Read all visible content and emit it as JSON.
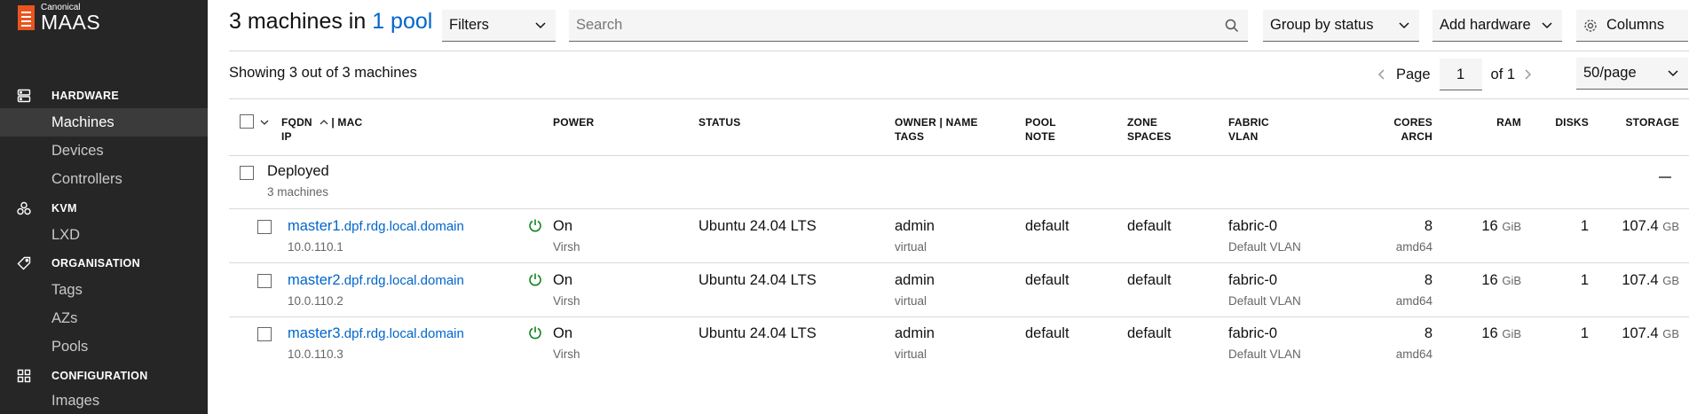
{
  "sidebar": {
    "brand_small": "Canonical",
    "brand_big": "MAAS",
    "sections": [
      {
        "label": "HARDWARE",
        "icon": "server-icon"
      },
      {
        "label": "KVM",
        "icon": "cluster-icon"
      },
      {
        "label": "ORGANISATION",
        "icon": "tag-icon"
      },
      {
        "label": "CONFIGURATION",
        "icon": "grid-icon"
      }
    ],
    "items": {
      "machines": "Machines",
      "devices": "Devices",
      "controllers": "Controllers",
      "lxd": "LXD",
      "tags": "Tags",
      "azs": "AZs",
      "pools": "Pools",
      "images": "Images"
    }
  },
  "header": {
    "title_prefix": "3 machines in ",
    "title_link": "1 pool",
    "filters_label": "Filters",
    "search_placeholder": "Search",
    "group_by_label": "Group by status",
    "add_hardware_label": "Add hardware",
    "columns_label": "Columns"
  },
  "summary": {
    "showing": "Showing 3 out of 3 machines",
    "page_label": "Page",
    "page_value": "1",
    "page_of": "of 1",
    "per_page": "50/page"
  },
  "table": {
    "headers": {
      "fqdn": "FQDN",
      "mac": "| MAC",
      "ip": "IP",
      "power": "POWER",
      "status": "STATUS",
      "owner": "OWNER | NAME",
      "tags": "TAGS",
      "pool": "POOL",
      "note": "NOTE",
      "zone": "ZONE",
      "spaces": "SPACES",
      "fabric": "FABRIC",
      "vlan": "VLAN",
      "cores": "CORES",
      "arch": "ARCH",
      "ram": "RAM",
      "disks": "DISKS",
      "storage": "STORAGE"
    },
    "group": {
      "name": "Deployed",
      "count": "3 machines"
    },
    "rows": [
      {
        "host": "master1",
        "domain": ".dpf.rdg.local.domain",
        "ip": "10.0.110.1",
        "power": "On",
        "power_type": "Virsh",
        "status": "Ubuntu 24.04 LTS",
        "owner": "admin",
        "tags": "virtual",
        "pool": "default",
        "zone": "default",
        "fabric": "fabric-0",
        "vlan": "Default VLAN",
        "cores": "8",
        "arch": "amd64",
        "ram": "16",
        "ram_unit": "GiB",
        "disks": "1",
        "storage": "107.4",
        "storage_unit": "GB"
      },
      {
        "host": "master2",
        "domain": ".dpf.rdg.local.domain",
        "ip": "10.0.110.2",
        "power": "On",
        "power_type": "Virsh",
        "status": "Ubuntu 24.04 LTS",
        "owner": "admin",
        "tags": "virtual",
        "pool": "default",
        "zone": "default",
        "fabric": "fabric-0",
        "vlan": "Default VLAN",
        "cores": "8",
        "arch": "amd64",
        "ram": "16",
        "ram_unit": "GiB",
        "disks": "1",
        "storage": "107.4",
        "storage_unit": "GB"
      },
      {
        "host": "master3",
        "domain": ".dpf.rdg.local.domain",
        "ip": "10.0.110.3",
        "power": "On",
        "power_type": "Virsh",
        "status": "Ubuntu 24.04 LTS",
        "owner": "admin",
        "tags": "virtual",
        "pool": "default",
        "zone": "default",
        "fabric": "fabric-0",
        "vlan": "Default VLAN",
        "cores": "8",
        "arch": "amd64",
        "ram": "16",
        "ram_unit": "GiB",
        "disks": "1",
        "storage": "107.4",
        "storage_unit": "GB"
      }
    ]
  },
  "colors": {
    "sidebar_bg": "#262626",
    "brand_orange": "#e95420",
    "link_blue": "#0066cc",
    "power_on_green": "#0e8420"
  }
}
